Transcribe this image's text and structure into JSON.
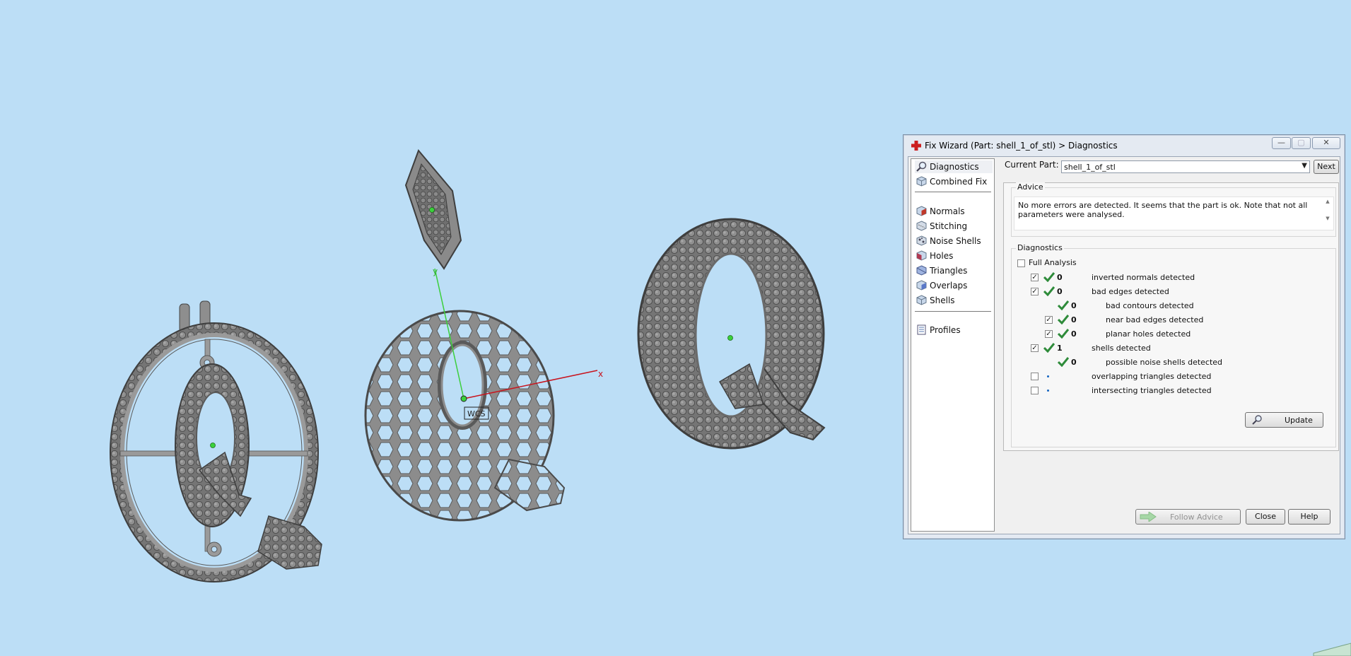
{
  "viewport": {
    "axis_labels": {
      "x": "x",
      "y": "y",
      "wcs": "WCS"
    },
    "models": [
      {
        "name": "Q oval pendant with bails"
      },
      {
        "name": "Q honeycomb pendant"
      },
      {
        "name": "Q pave pendant"
      }
    ]
  },
  "dialog": {
    "title": "Fix Wizard (Part: shell_1_of_stl) > Diagnostics",
    "window_buttons": {
      "minimize": "—",
      "maximize": "▢",
      "close": "✕"
    },
    "nav": {
      "group1": [
        {
          "label": "Diagnostics",
          "icon": "magnifier-icon",
          "selected": true
        },
        {
          "label": "Combined Fix",
          "icon": "cube-icon"
        }
      ],
      "group2": [
        {
          "label": "Normals",
          "icon": "normals-cube-icon"
        },
        {
          "label": "Stitching",
          "icon": "stitching-cube-icon"
        },
        {
          "label": "Noise Shells",
          "icon": "noise-shells-icon"
        },
        {
          "label": "Holes",
          "icon": "holes-cube-icon"
        },
        {
          "label": "Triangles",
          "icon": "triangles-cube-icon"
        },
        {
          "label": "Overlaps",
          "icon": "overlaps-cube-icon"
        },
        {
          "label": "Shells",
          "icon": "shells-cube-icon"
        }
      ],
      "group3": [
        {
          "label": "Profiles",
          "icon": "profiles-document-icon"
        }
      ]
    },
    "current_part_label": "Current Part:",
    "current_part_value": "shell_1_of_stl",
    "next_label": "Next",
    "advice": {
      "title": "Advice",
      "text": "No more errors are detected. It seems that the part is ok. Note that not all parameters were analysed."
    },
    "diagnostics": {
      "title": "Diagnostics",
      "full_analysis_label": "Full Analysis",
      "full_analysis_checked": false,
      "rows": [
        {
          "label": "inverted normals detected",
          "count": "0",
          "checked": true,
          "status": "ok",
          "indent": 0
        },
        {
          "label": "bad edges detected",
          "count": "0",
          "checked": true,
          "status": "ok",
          "indent": 0
        },
        {
          "label": "bad contours detected",
          "count": "0",
          "checked": null,
          "status": "ok",
          "indent": 1
        },
        {
          "label": "near bad edges detected",
          "count": "0",
          "checked": true,
          "status": "ok",
          "indent": 1
        },
        {
          "label": "planar holes detected",
          "count": "0",
          "checked": true,
          "status": "ok",
          "indent": 1
        },
        {
          "label": "shells detected",
          "count": "1",
          "checked": true,
          "status": "ok",
          "indent": 0
        },
        {
          "label": "possible noise shells detected",
          "count": "0",
          "checked": null,
          "status": "ok",
          "indent": 1
        },
        {
          "label": "overlapping triangles detected",
          "count": "",
          "checked": false,
          "status": "not-run",
          "indent": 0
        },
        {
          "label": "intersecting triangles detected",
          "count": "",
          "checked": false,
          "status": "not-run",
          "indent": 0
        }
      ],
      "update_label": "Update"
    },
    "footer": {
      "follow_advice_label": "Follow Advice",
      "follow_advice_enabled": false,
      "close_label": "Close",
      "help_label": "Help"
    },
    "colors": {
      "check_green": "#2e8b3a",
      "title_icon_red": "#cc1f1f",
      "viewport_bg": "#bcdef6",
      "axis_x": "#c8141e",
      "axis_y": "#3ccf3c"
    }
  }
}
